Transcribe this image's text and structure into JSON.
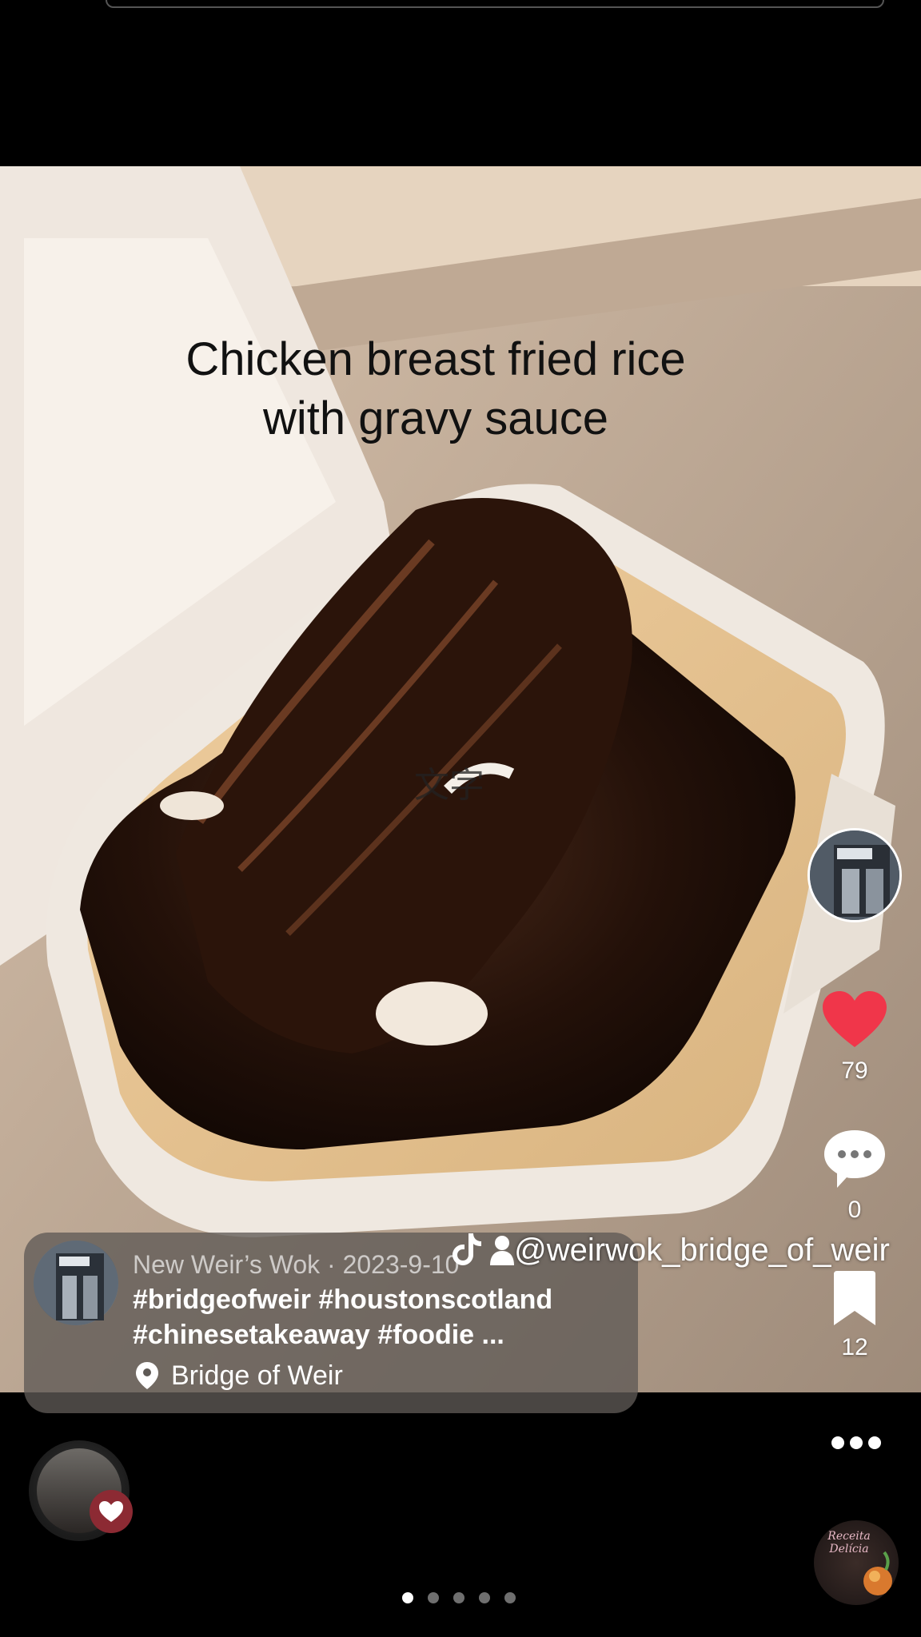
{
  "post": {
    "overlay_text": [
      "Chicken breast fried rice",
      "with gravy sauce"
    ],
    "watermark": "文字",
    "author": {
      "display_meta": "New Weir’s Wok · 2023-9-10",
      "handle": "@weirwok_bridge_of_weir"
    },
    "hashtags": [
      "#bridgeofweir #houstonscotland",
      "#chinesetakeaway #foodie ..."
    ],
    "location": "Bridge of Weir"
  },
  "actions": {
    "likes": "79",
    "comments": "0",
    "saves": "12"
  },
  "music_disc_label": "Receita Delícia",
  "pagination": {
    "count": 5,
    "active_index": 0
  },
  "colors": {
    "like": "#f0364a",
    "background": "#000000",
    "card": "#5f5a56"
  },
  "icons": [
    "heart-icon",
    "comment-icon",
    "bookmark-icon",
    "location-pin-icon",
    "tiktok-icon",
    "person-icon",
    "more-icon"
  ]
}
